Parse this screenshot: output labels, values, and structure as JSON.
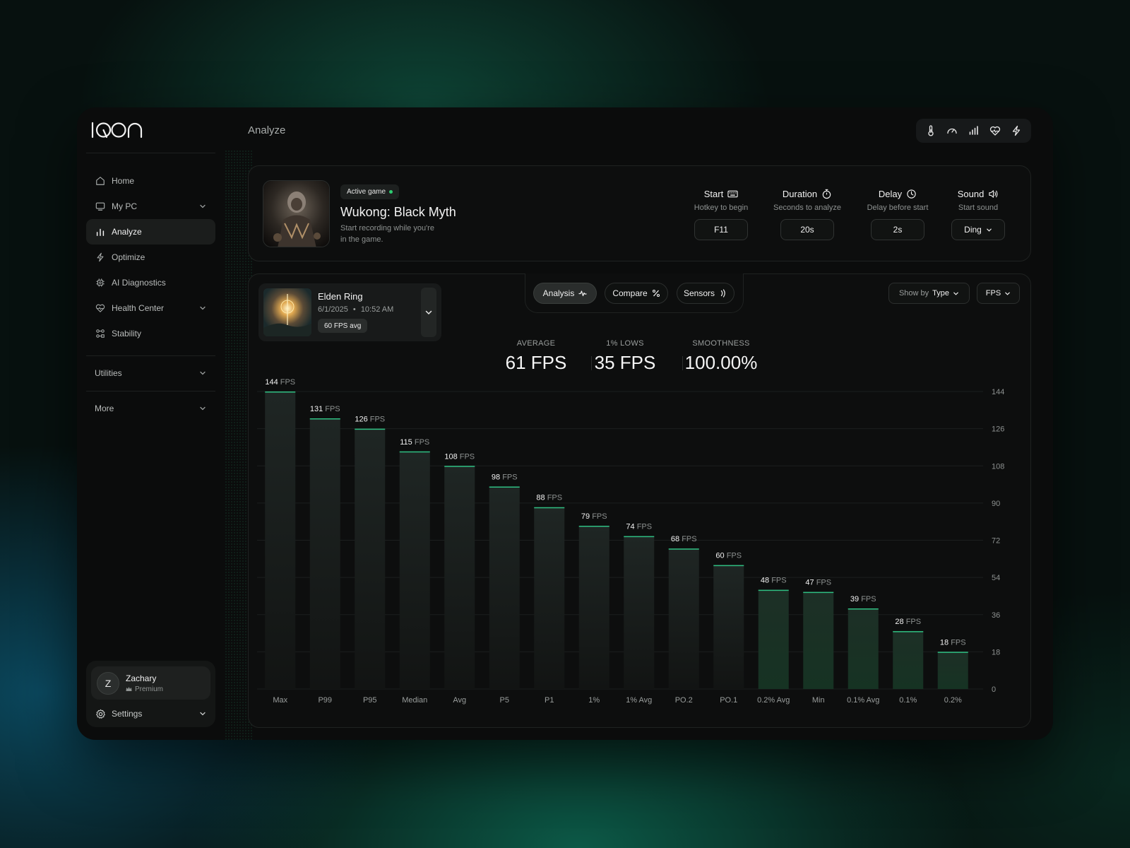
{
  "app": {
    "logo_text": "IQON",
    "page_title": "Analyze"
  },
  "sidebar": {
    "items": [
      {
        "label": "Home",
        "icon": "home-icon",
        "active": false,
        "has_chevron": false
      },
      {
        "label": "My PC",
        "icon": "monitor-icon",
        "active": false,
        "has_chevron": true
      },
      {
        "label": "Analyze",
        "icon": "bar-chart-icon",
        "active": true,
        "has_chevron": false
      },
      {
        "label": "Optimize",
        "icon": "bolt-icon",
        "active": false,
        "has_chevron": false
      },
      {
        "label": "AI Diagnostics",
        "icon": "chip-icon",
        "active": false,
        "has_chevron": false
      },
      {
        "label": "Health Center",
        "icon": "heart-pulse-icon",
        "active": false,
        "has_chevron": true
      },
      {
        "label": "Stability",
        "icon": "nodes-icon",
        "active": false,
        "has_chevron": false
      }
    ],
    "sections": [
      {
        "label": "Utilities"
      },
      {
        "label": "More"
      }
    ],
    "user": {
      "initial": "Z",
      "name": "Zachary",
      "plan": "Premium"
    },
    "settings_label": "Settings"
  },
  "toolbar": {
    "icons": [
      "thermometer-icon",
      "gauge-icon",
      "signal-bars-icon",
      "heart-pulse-icon",
      "lightning-icon"
    ]
  },
  "active_game": {
    "badge": "Active game",
    "title": "Wukong: Black Myth",
    "subtitle": "Start recording while you're in the game."
  },
  "capture_settings": [
    {
      "label": "Start",
      "sub": "Hotkey to begin",
      "value": "F11",
      "icon": "keyboard-icon",
      "dropdown": false
    },
    {
      "label": "Duration",
      "sub": "Seconds to analyze",
      "value": "20s",
      "icon": "stopwatch-icon",
      "dropdown": false
    },
    {
      "label": "Delay",
      "sub": "Delay before start",
      "value": "2s",
      "icon": "clock-icon",
      "dropdown": false
    },
    {
      "label": "Sound",
      "sub": "Start sound",
      "value": "Ding",
      "icon": "speaker-icon",
      "dropdown": true
    }
  ],
  "session": {
    "title": "Elden Ring",
    "date": "6/1/2025",
    "time": "10:52 AM",
    "badge": "60 FPS avg"
  },
  "tabs": [
    {
      "label": "Analysis",
      "icon": "pulse-icon",
      "active": true
    },
    {
      "label": "Compare",
      "icon": "percent-icon",
      "active": false
    },
    {
      "label": "Sensors",
      "icon": "signal-waves-icon",
      "active": false
    }
  ],
  "filters": {
    "show_by_prefix": "Show by",
    "show_by_value": "Type",
    "metric": "FPS"
  },
  "stats": [
    {
      "label": "AVERAGE",
      "value": "61 FPS"
    },
    {
      "label": "1% LOWS",
      "value": "35 FPS"
    },
    {
      "label": "SMOOTHNESS",
      "value": "100.00%"
    }
  ],
  "chart_data": {
    "type": "bar",
    "categories": [
      "Max",
      "P99",
      "P95",
      "Median",
      "Avg",
      "P5",
      "P1",
      "1%",
      "1% Avg",
      "PO.2",
      "PO.1",
      "0.2% Avg",
      "Min",
      "0.1% Avg",
      "0.1%",
      "0.2%"
    ],
    "values": [
      144,
      131,
      126,
      115,
      108,
      98,
      88,
      79,
      74,
      68,
      60,
      48,
      47,
      39,
      28,
      18
    ],
    "value_unit": "FPS",
    "ylim": [
      0,
      144
    ],
    "yticks": [
      0,
      18,
      36,
      54,
      72,
      90,
      108,
      126,
      144
    ],
    "grid": true,
    "y_axis_side": "right",
    "colors": {
      "bar_top": "#1f2624",
      "bar_bottom": "#121413",
      "accent": "#2fbf82",
      "accent_low": "#1e6a45"
    }
  }
}
